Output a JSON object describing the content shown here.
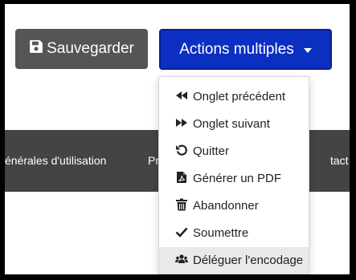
{
  "toolbar": {
    "save_label": "Sauvegarder",
    "actions_label": "Actions multiples"
  },
  "footer": {
    "link1": "énérales d'utilisation",
    "link2": "Pr",
    "link3": "tact"
  },
  "menu": {
    "items": [
      {
        "label": "Onglet précédent",
        "icon": "backward-icon"
      },
      {
        "label": "Onglet suivant",
        "icon": "forward-icon"
      },
      {
        "label": "Quitter",
        "icon": "undo-icon"
      },
      {
        "label": "Générer un PDF",
        "icon": "pdf-file-icon"
      },
      {
        "label": "Abandonner",
        "icon": "trash-icon"
      },
      {
        "label": "Soumettre",
        "icon": "check-icon"
      },
      {
        "label": "Déléguer l'encodage",
        "icon": "users-icon",
        "highlighted": true
      }
    ]
  },
  "colors": {
    "primary": "#0b2fc1",
    "save_button": "#555555",
    "footer_bar": "#444444",
    "menu_highlight": "#e9e9e9"
  }
}
